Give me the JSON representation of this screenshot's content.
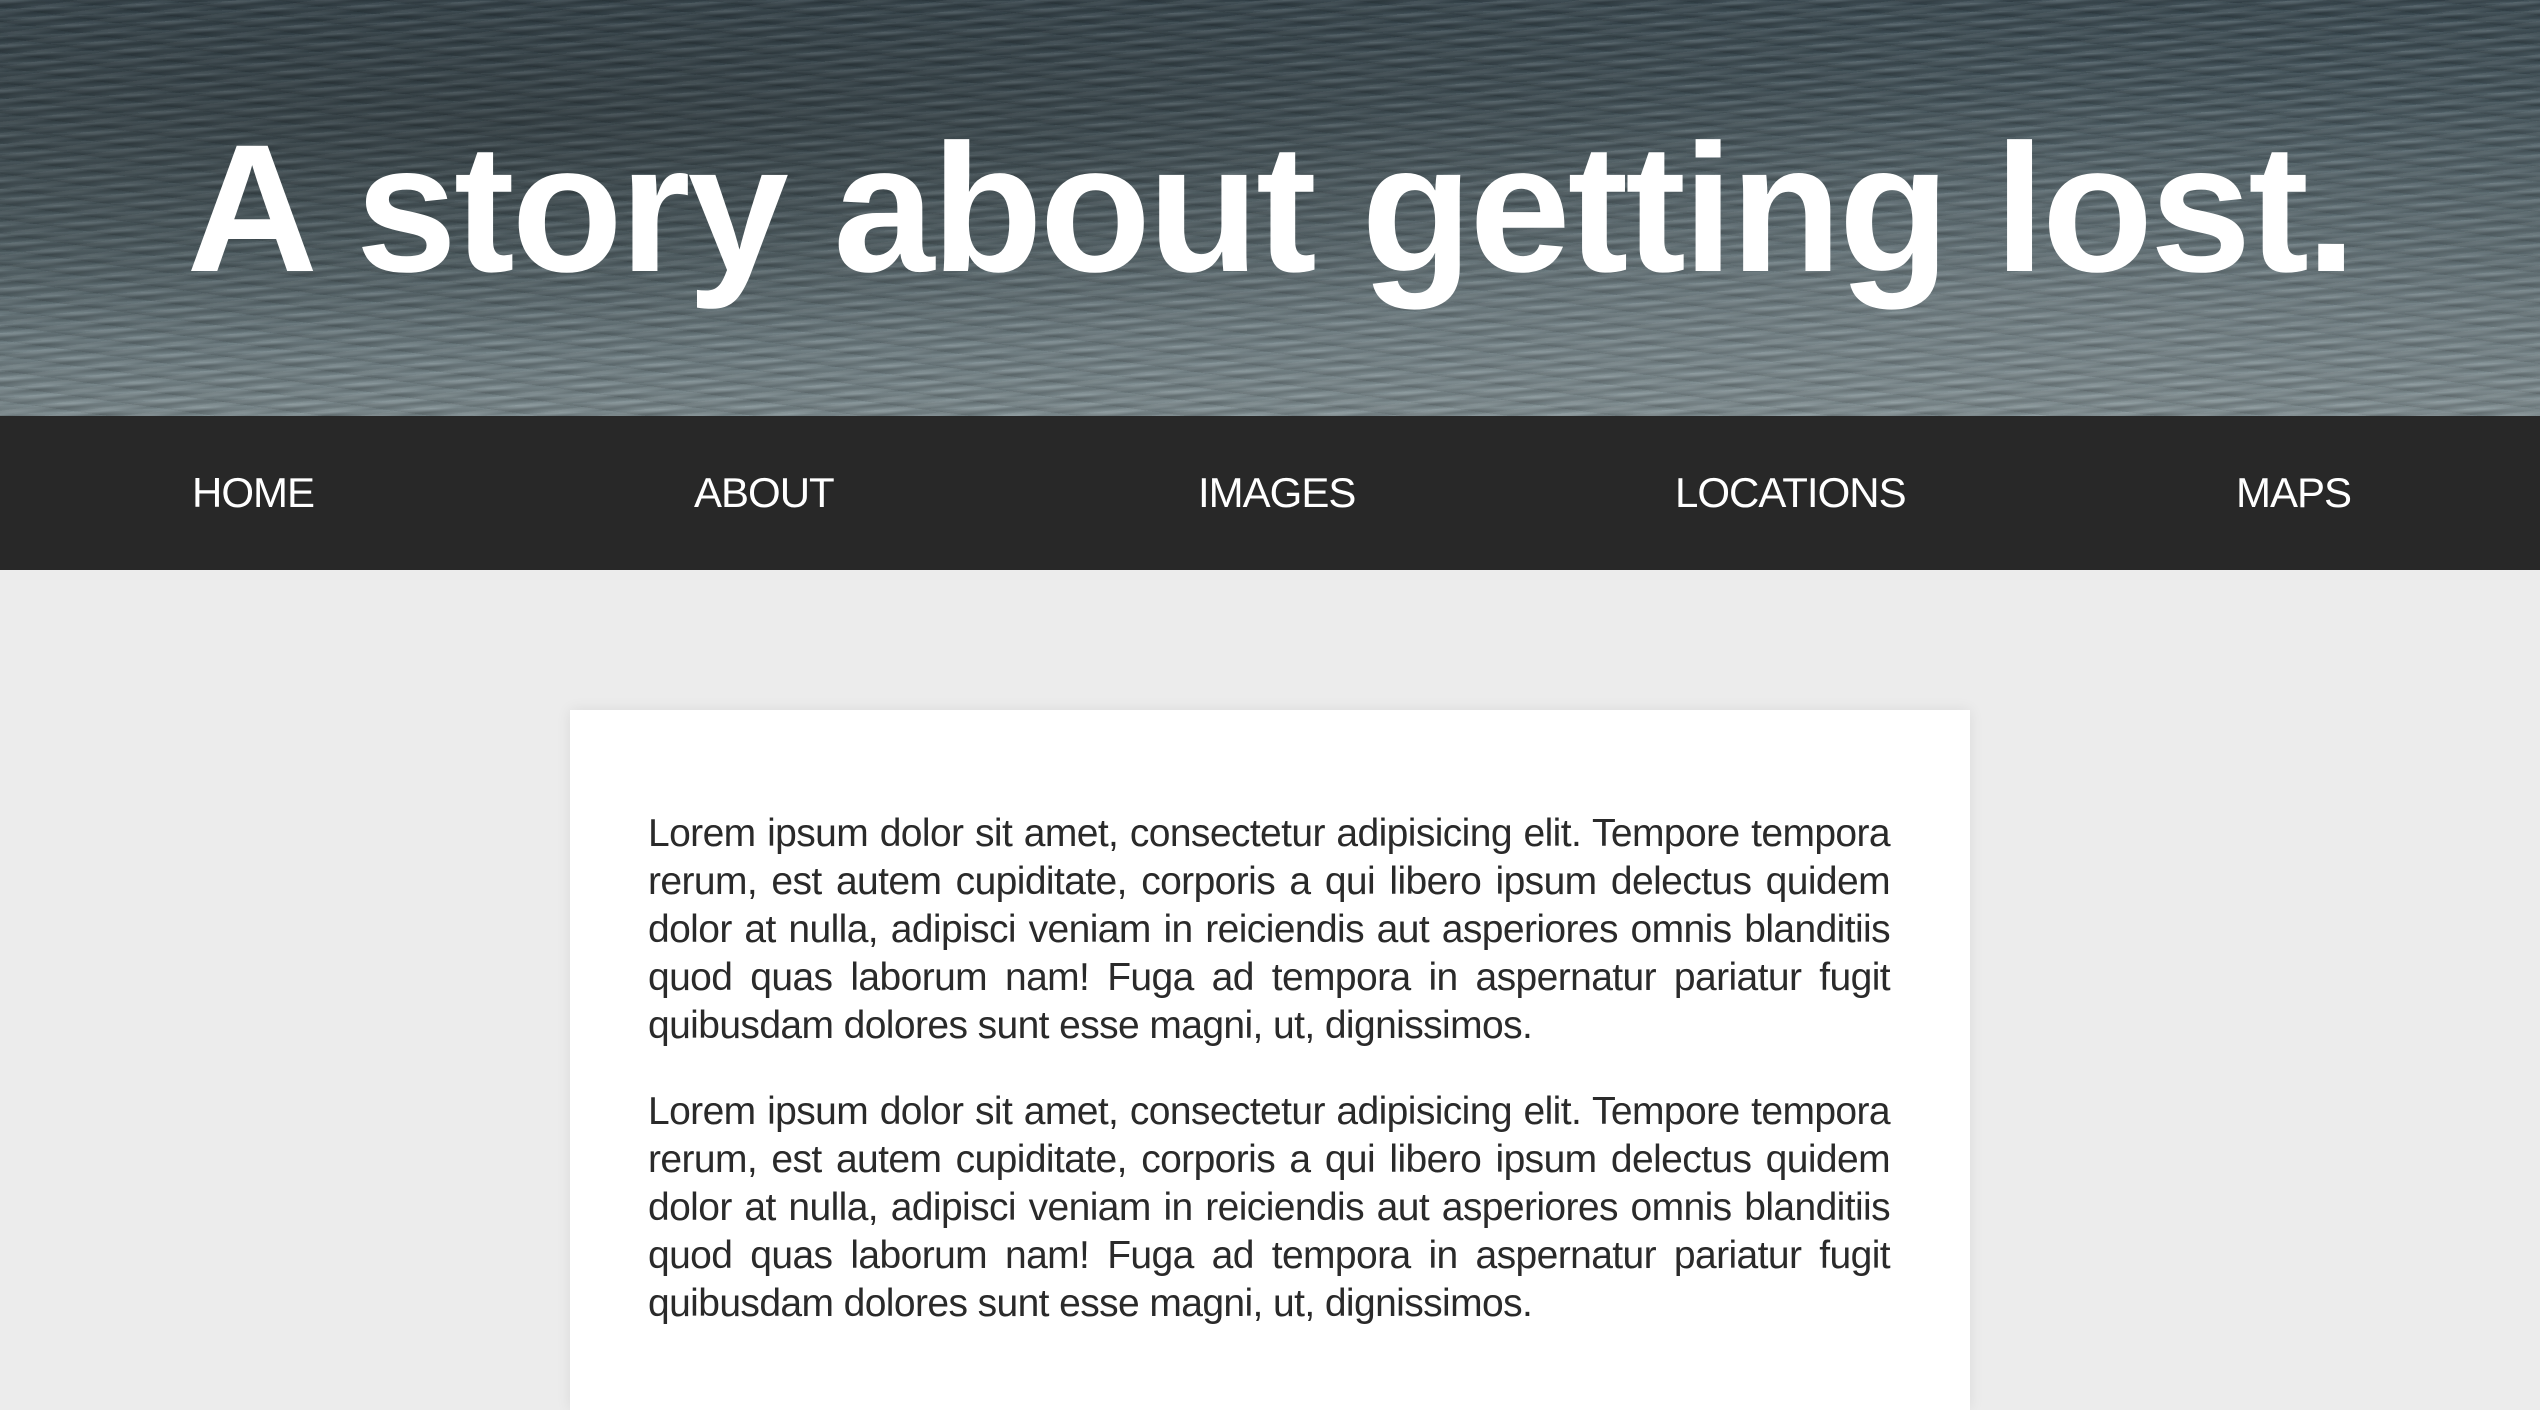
{
  "hero": {
    "title": "A story about getting lost."
  },
  "nav": {
    "items": [
      {
        "label": "HOME"
      },
      {
        "label": "ABOUT"
      },
      {
        "label": "IMAGES"
      },
      {
        "label": "LOCATIONS"
      },
      {
        "label": "MAPS"
      }
    ]
  },
  "content": {
    "paragraphs": [
      "Lorem ipsum dolor sit amet, consectetur adipisicing elit. Tempore tempora rerum, est autem cupiditate, corporis a qui libero ipsum delectus quidem dolor at nulla, adipisci veniam in reiciendis aut asperiores omnis blanditiis quod quas laborum nam! Fuga ad tempora in aspernatur pariatur fugit quibusdam dolores sunt esse magni, ut, dignissimos.",
      "Lorem ipsum dolor sit amet, consectetur adipisicing elit. Tempore tempora rerum, est autem cupiditate, corporis a qui libero ipsum delectus quidem dolor at nulla, adipisci veniam in reiciendis aut asperiores omnis blanditiis quod quas laborum nam! Fuga ad tempora in aspernatur pariatur fugit quibusdam dolores sunt esse magni, ut, dignissimos."
    ]
  },
  "colors": {
    "nav_background": "#282828",
    "page_background": "#ececec",
    "card_background": "#ffffff",
    "hero_text": "#ffffff"
  }
}
